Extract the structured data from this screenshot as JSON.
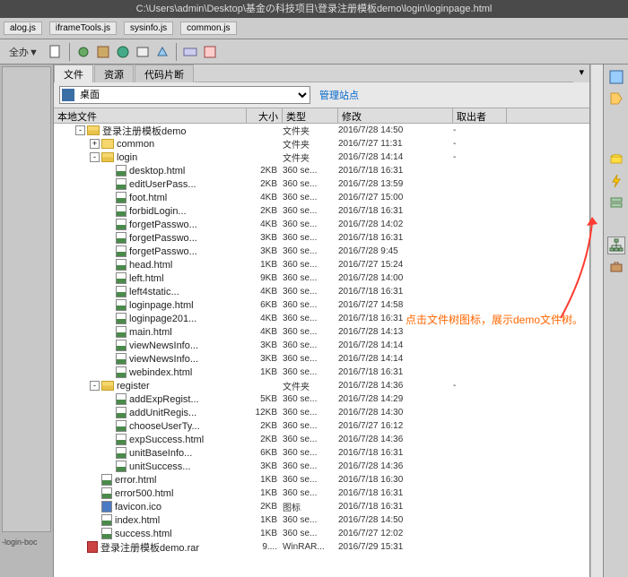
{
  "title_path": "C:\\Users\\admin\\Desktop\\基金の科技项目\\登录注册模板demo\\login\\loginpage.html",
  "open_tabs": [
    "alog.js",
    "iframeTools.js",
    "sysinfo.js",
    "common.js"
  ],
  "toolbar_label": "全办▼",
  "panel_tabs": {
    "active": "文件",
    "others": [
      "资源",
      "代码片断"
    ]
  },
  "location": {
    "label": "桌面",
    "link": "管理站点"
  },
  "columns": {
    "name": "本地文件",
    "size": "大小",
    "type": "类型",
    "date": "修改",
    "user": "取出者"
  },
  "folder_type": "文件夹",
  "tree": [
    {
      "depth": 1,
      "exp": "-",
      "kind": "folder-open",
      "name": "登录注册模板demo",
      "size": "",
      "type": "文件夹",
      "date": "2016/7/28 14:50",
      "user": "-"
    },
    {
      "depth": 2,
      "exp": "+",
      "kind": "folder",
      "name": "common",
      "size": "",
      "type": "文件夹",
      "date": "2016/7/27 11:31",
      "user": "-"
    },
    {
      "depth": 2,
      "exp": "-",
      "kind": "folder-open",
      "name": "login",
      "size": "",
      "type": "文件夹",
      "date": "2016/7/28 14:14",
      "user": "-"
    },
    {
      "depth": 3,
      "kind": "html",
      "name": "desktop.html",
      "size": "2KB",
      "type": "360 se...",
      "date": "2016/7/18 16:31",
      "user": ""
    },
    {
      "depth": 3,
      "kind": "html",
      "name": "editUserPass...",
      "size": "2KB",
      "type": "360 se...",
      "date": "2016/7/28 13:59",
      "user": ""
    },
    {
      "depth": 3,
      "kind": "html",
      "name": "foot.html",
      "size": "4KB",
      "type": "360 se...",
      "date": "2016/7/27 15:00",
      "user": ""
    },
    {
      "depth": 3,
      "kind": "html",
      "name": "forbidLogin...",
      "size": "2KB",
      "type": "360 se...",
      "date": "2016/7/18 16:31",
      "user": ""
    },
    {
      "depth": 3,
      "kind": "html",
      "name": "forgetPasswo...",
      "size": "4KB",
      "type": "360 se...",
      "date": "2016/7/28 14:02",
      "user": ""
    },
    {
      "depth": 3,
      "kind": "html",
      "name": "forgetPasswo...",
      "size": "3KB",
      "type": "360 se...",
      "date": "2016/7/18 16:31",
      "user": ""
    },
    {
      "depth": 3,
      "kind": "html",
      "name": "forgetPasswo...",
      "size": "3KB",
      "type": "360 se...",
      "date": "2016/7/28 9:45",
      "user": ""
    },
    {
      "depth": 3,
      "kind": "html",
      "name": "head.html",
      "size": "1KB",
      "type": "360 se...",
      "date": "2016/7/27 15:24",
      "user": ""
    },
    {
      "depth": 3,
      "kind": "html",
      "name": "left.html",
      "size": "9KB",
      "type": "360 se...",
      "date": "2016/7/28 14:00",
      "user": ""
    },
    {
      "depth": 3,
      "kind": "html",
      "name": "left4static...",
      "size": "4KB",
      "type": "360 se...",
      "date": "2016/7/18 16:31",
      "user": ""
    },
    {
      "depth": 3,
      "kind": "html",
      "name": "loginpage.html",
      "size": "6KB",
      "type": "360 se...",
      "date": "2016/7/27 14:58",
      "user": ""
    },
    {
      "depth": 3,
      "kind": "html",
      "name": "loginpage201...",
      "size": "4KB",
      "type": "360 se...",
      "date": "2016/7/18 16:31",
      "user": ""
    },
    {
      "depth": 3,
      "kind": "html",
      "name": "main.html",
      "size": "4KB",
      "type": "360 se...",
      "date": "2016/7/28 14:13",
      "user": ""
    },
    {
      "depth": 3,
      "kind": "html",
      "name": "viewNewsInfo...",
      "size": "3KB",
      "type": "360 se...",
      "date": "2016/7/28 14:14",
      "user": ""
    },
    {
      "depth": 3,
      "kind": "html",
      "name": "viewNewsInfo...",
      "size": "3KB",
      "type": "360 se...",
      "date": "2016/7/28 14:14",
      "user": ""
    },
    {
      "depth": 3,
      "kind": "html",
      "name": "webindex.html",
      "size": "1KB",
      "type": "360 se...",
      "date": "2016/7/18 16:31",
      "user": ""
    },
    {
      "depth": 2,
      "exp": "-",
      "kind": "folder-open",
      "name": "register",
      "size": "",
      "type": "文件夹",
      "date": "2016/7/28 14:36",
      "user": "-"
    },
    {
      "depth": 3,
      "kind": "html",
      "name": "addExpRegist...",
      "size": "5KB",
      "type": "360 se...",
      "date": "2016/7/28 14:29",
      "user": ""
    },
    {
      "depth": 3,
      "kind": "html",
      "name": "addUnitRegis...",
      "size": "12KB",
      "type": "360 se...",
      "date": "2016/7/28 14:30",
      "user": ""
    },
    {
      "depth": 3,
      "kind": "html",
      "name": "chooseUserTy...",
      "size": "2KB",
      "type": "360 se...",
      "date": "2016/7/27 16:12",
      "user": ""
    },
    {
      "depth": 3,
      "kind": "html",
      "name": "expSuccess.html",
      "size": "2KB",
      "type": "360 se...",
      "date": "2016/7/28 14:36",
      "user": ""
    },
    {
      "depth": 3,
      "kind": "html",
      "name": "unitBaseInfo...",
      "size": "6KB",
      "type": "360 se...",
      "date": "2016/7/18 16:31",
      "user": ""
    },
    {
      "depth": 3,
      "kind": "html",
      "name": "unitSuccess...",
      "size": "3KB",
      "type": "360 se...",
      "date": "2016/7/28 14:36",
      "user": ""
    },
    {
      "depth": 2,
      "kind": "html",
      "name": "error.html",
      "size": "1KB",
      "type": "360 se...",
      "date": "2016/7/18 16:30",
      "user": ""
    },
    {
      "depth": 2,
      "kind": "html",
      "name": "error500.html",
      "size": "1KB",
      "type": "360 se...",
      "date": "2016/7/18 16:31",
      "user": ""
    },
    {
      "depth": 2,
      "kind": "ico",
      "name": "favicon.ico",
      "size": "2KB",
      "type": "图标",
      "date": "2016/7/18 16:31",
      "user": ""
    },
    {
      "depth": 2,
      "kind": "html",
      "name": "index.html",
      "size": "1KB",
      "type": "360 se...",
      "date": "2016/7/28 14:50",
      "user": ""
    },
    {
      "depth": 2,
      "kind": "html",
      "name": "success.html",
      "size": "1KB",
      "type": "360 se...",
      "date": "2016/7/27 12:02",
      "user": ""
    },
    {
      "depth": 1,
      "kind": "rar",
      "name": "登录注册模板demo.rar",
      "size": "9....",
      "type": "WinRAR...",
      "date": "2016/7/29 15:31",
      "user": ""
    }
  ],
  "annotation": "点击文件树图标，展示demo文件树。",
  "left_footer": "-login-boc",
  "right_icons": [
    "css-icon",
    "tag-icon",
    "db-icon",
    "lightning-icon",
    "server-icon",
    "tree-icon",
    "briefcase-icon"
  ],
  "colors": {
    "accent": "#ff6600"
  }
}
